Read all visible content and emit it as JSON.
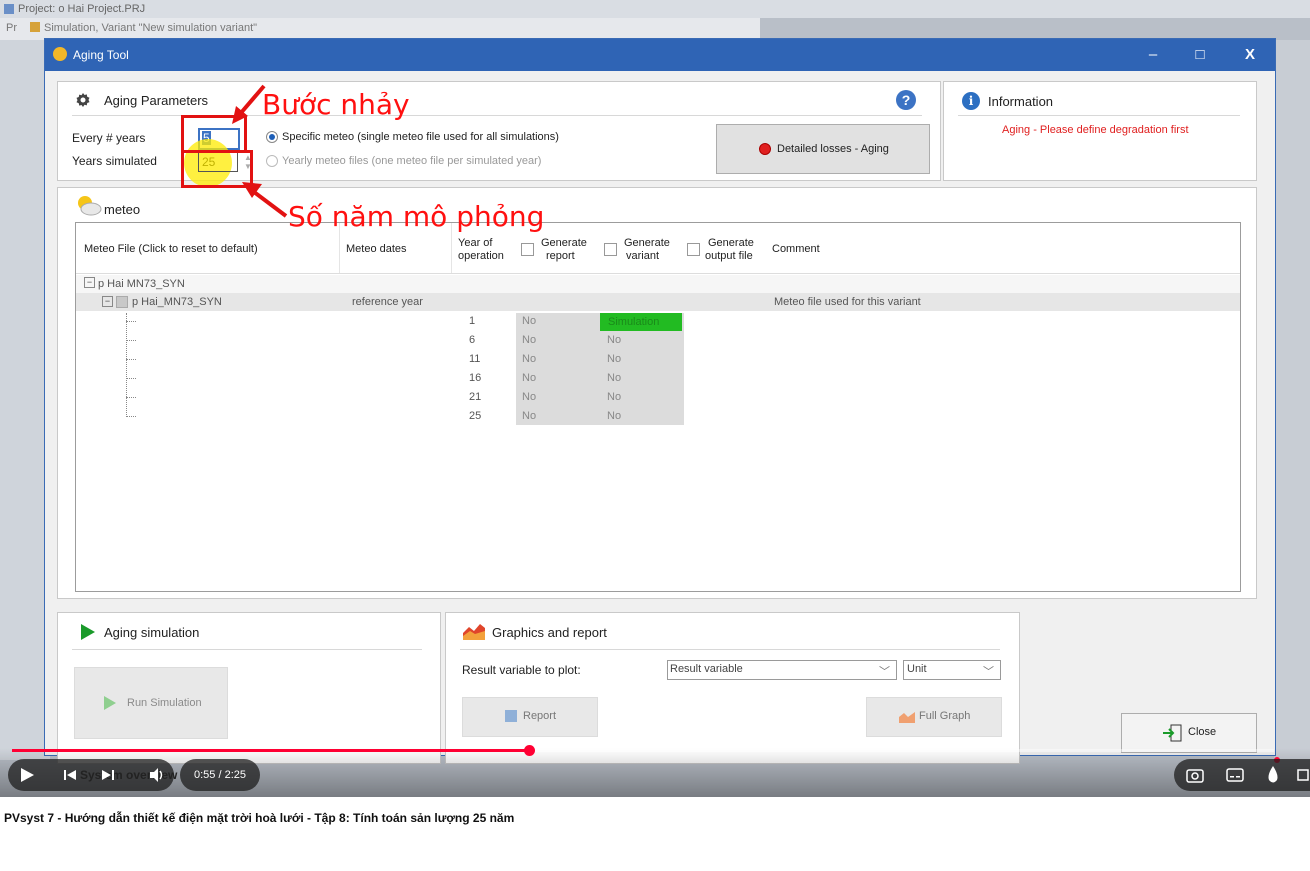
{
  "background": {
    "project_title": "Project:  o Hai  Project.PRJ",
    "sim_title": "Simulation, Variant  \"New simulation variant\"",
    "left_letters": "Pr"
  },
  "window": {
    "title": "Aging Tool",
    "minimize": "–",
    "maximize": "□",
    "close": "X"
  },
  "aging_params": {
    "title": "Aging Parameters",
    "every_label": "Every # years",
    "every_value": "5",
    "years_label": "Years simulated",
    "years_value": "25",
    "radio_specific": "Specific meteo (single meteo file used for all simulations)",
    "radio_yearly": "Yearly meteo files (one meteo file per simulated year)",
    "help": "?",
    "detailed_losses_button": "Detailed losses - Aging"
  },
  "information": {
    "title": "Information",
    "message": "Aging - Please define degradation first"
  },
  "annotations": {
    "step": "Bước nhảy",
    "years": "Số năm mô phỏng"
  },
  "meteo": {
    "title": "meteo",
    "headers": {
      "file": "Meteo File (Click to reset to default)",
      "dates": "Meteo dates",
      "year_op_1": "Year of",
      "year_op_2": "operation",
      "gen_report_1": "Generate",
      "gen_report_2": "report",
      "gen_variant_1": "Generate",
      "gen_variant_2": "variant",
      "gen_output_1": "Generate",
      "gen_output_2": "output file",
      "comment": "Comment"
    },
    "root_node": "p Hai MN73_SYN",
    "child_node": "p Hai_MN73_SYN",
    "child_dates": "reference year",
    "child_comment": "Meteo file used for this variant",
    "rows": [
      {
        "year": "1",
        "report": "No",
        "variant": "Simulation"
      },
      {
        "year": "6",
        "report": "No",
        "variant": "No"
      },
      {
        "year": "11",
        "report": "No",
        "variant": "No"
      },
      {
        "year": "16",
        "report": "No",
        "variant": "No"
      },
      {
        "year": "21",
        "report": "No",
        "variant": "No"
      },
      {
        "year": "25",
        "report": "No",
        "variant": "No"
      }
    ]
  },
  "aging_sim": {
    "title": "Aging simulation",
    "run_button": "Run Simulation"
  },
  "graphics": {
    "title": "Graphics and report",
    "result_label": "Result variable to plot:",
    "result_select": "Result variable",
    "unit_select": "Unit",
    "report_button": "Report",
    "full_graph_button": "Full Graph"
  },
  "close_button": "Close",
  "player": {
    "time": "0:55 / 2:25",
    "chapter": "System overview",
    "progress": 0.41
  },
  "caption": "PVsyst 7 - Hướng dẫn thiết kế điện mặt trời hoà lưới - Tập 8: Tính toán sản lượng 25 năm",
  "colors": {
    "titlebar": "#2f64b5",
    "annotation": "#ff1010",
    "simulation_cell": "#22bb22",
    "progress": "#ff0033"
  }
}
